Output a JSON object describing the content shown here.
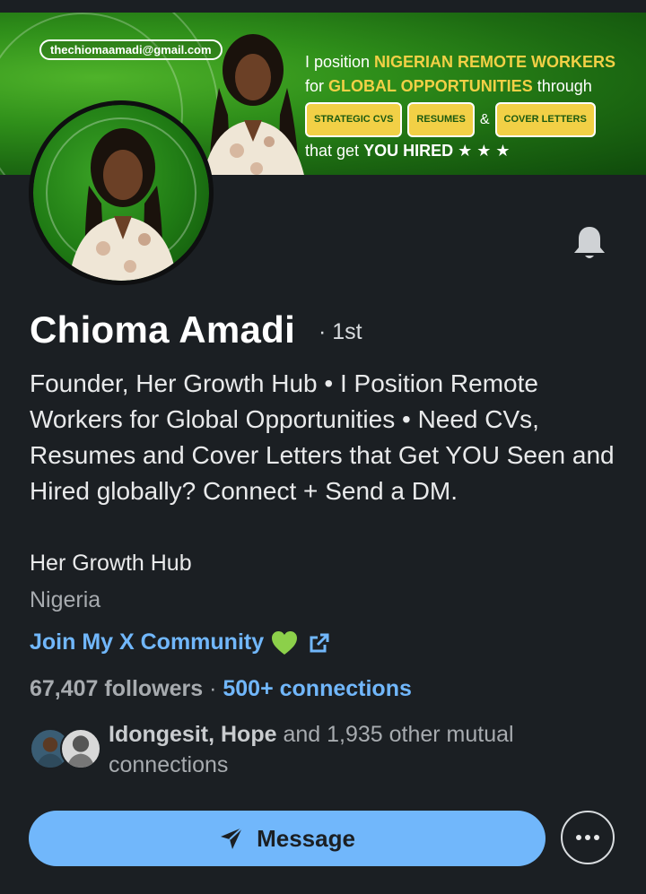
{
  "banner": {
    "email": "thechiomaamadi@gmail.com",
    "line1_a": "I position ",
    "line1_b": "NIGERIAN REMOTE WORKERS",
    "line2_a": "for ",
    "line2_b": "GLOBAL OPPORTUNITIES",
    "line2_c": " through",
    "pills": [
      "STRATEGIC CVS",
      "RESUMES",
      "COVER LETTERS"
    ],
    "amp": "&",
    "line4_a": "that get ",
    "line4_b": "YOU HIRED",
    "stars": "★ ★ ★"
  },
  "profile": {
    "name": "Chioma Amadi",
    "degree": "· 1st",
    "headline": "Founder, Her Growth Hub • I Position Remote Workers for Global Opportunities • Need CVs, Resumes and Cover Letters that Get YOU Seen and Hired globally? Connect + Send a DM.",
    "company": "Her Growth Hub",
    "location": "Nigeria",
    "community_link": "Join My X Community",
    "followers": "67,407 followers",
    "separator": " · ",
    "connections": "500+ connections",
    "mutual_names": "Idongesit, Hope",
    "mutual_rest": " and 1,935 other mutual connections"
  },
  "actions": {
    "message_label": "Message"
  },
  "icons": {
    "bell": "bell-icon",
    "heart": "green-heart-icon",
    "external": "external-link-icon",
    "send": "paper-plane-icon",
    "more": "more-horizontal-icon"
  },
  "colors": {
    "background": "#1b1f23",
    "link": "#71b7fb",
    "accent_yellow": "#f2d046"
  }
}
